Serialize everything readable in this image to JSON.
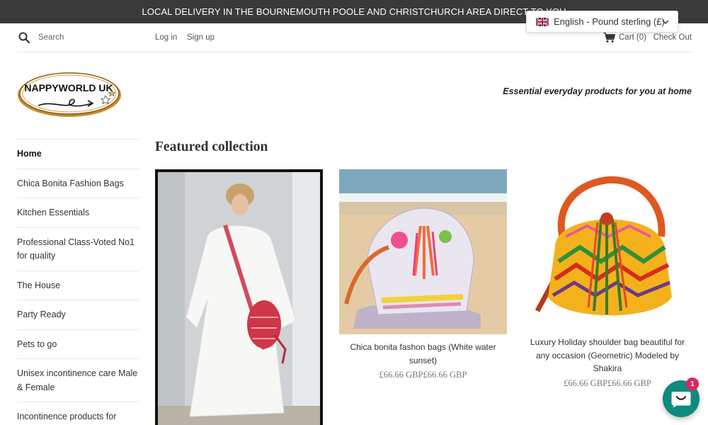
{
  "announcement": "LOCAL DELIVERY IN THE BOURNEMOUTH POOLE AND CHRISTCHURCH AREA DIRECT TO YOU",
  "header": {
    "search_label": "Search",
    "login": "Log in",
    "signup": "Sign up",
    "cart": "Cart (0)",
    "checkout": "Check Out"
  },
  "language_selector": {
    "label": "English - Pound sterling (£)",
    "flag": "uk-flag-icon"
  },
  "brand": {
    "logo_text": "NAPPYWORLD UK",
    "tagline": "Essential everyday products for you at home"
  },
  "sidebar": {
    "items": [
      {
        "label": "Home",
        "active": true
      },
      {
        "label": "Chica Bonita Fashion Bags",
        "active": false
      },
      {
        "label": "Kitchen Essentials",
        "active": false
      },
      {
        "label": "Professional Class-Voted No1 for quality",
        "active": false
      },
      {
        "label": "The House",
        "active": false
      },
      {
        "label": "Party Ready",
        "active": false
      },
      {
        "label": "Pets to go",
        "active": false
      },
      {
        "label": "Unisex incontinence care Male & Female",
        "active": false
      },
      {
        "label": "Incontinence products for Women",
        "active": false
      }
    ]
  },
  "main": {
    "featured_title": "Featured collection",
    "products": [
      {
        "image": "woman-in-white-dress-with-bag-image",
        "name": "",
        "price": ""
      },
      {
        "image": "beach-bag-white-water-sunset-image",
        "name": "Chica bonita fashon bags (White water sunset)",
        "price": "£66.66 GBP£66.66 GBP"
      },
      {
        "image": "geometric-shoulder-bag-image",
        "name": "Luxury Holiday shoulder bag beautiful for any occasion (Geometric) Modeled by Shakira",
        "price": "£66.66 GBP£66.66 GBP"
      }
    ]
  },
  "chat": {
    "badge_count": "1"
  },
  "colors": {
    "announcement_bg": "#3a3a3a",
    "chat_button": "#0f8a7e",
    "badge": "#e0245e"
  }
}
